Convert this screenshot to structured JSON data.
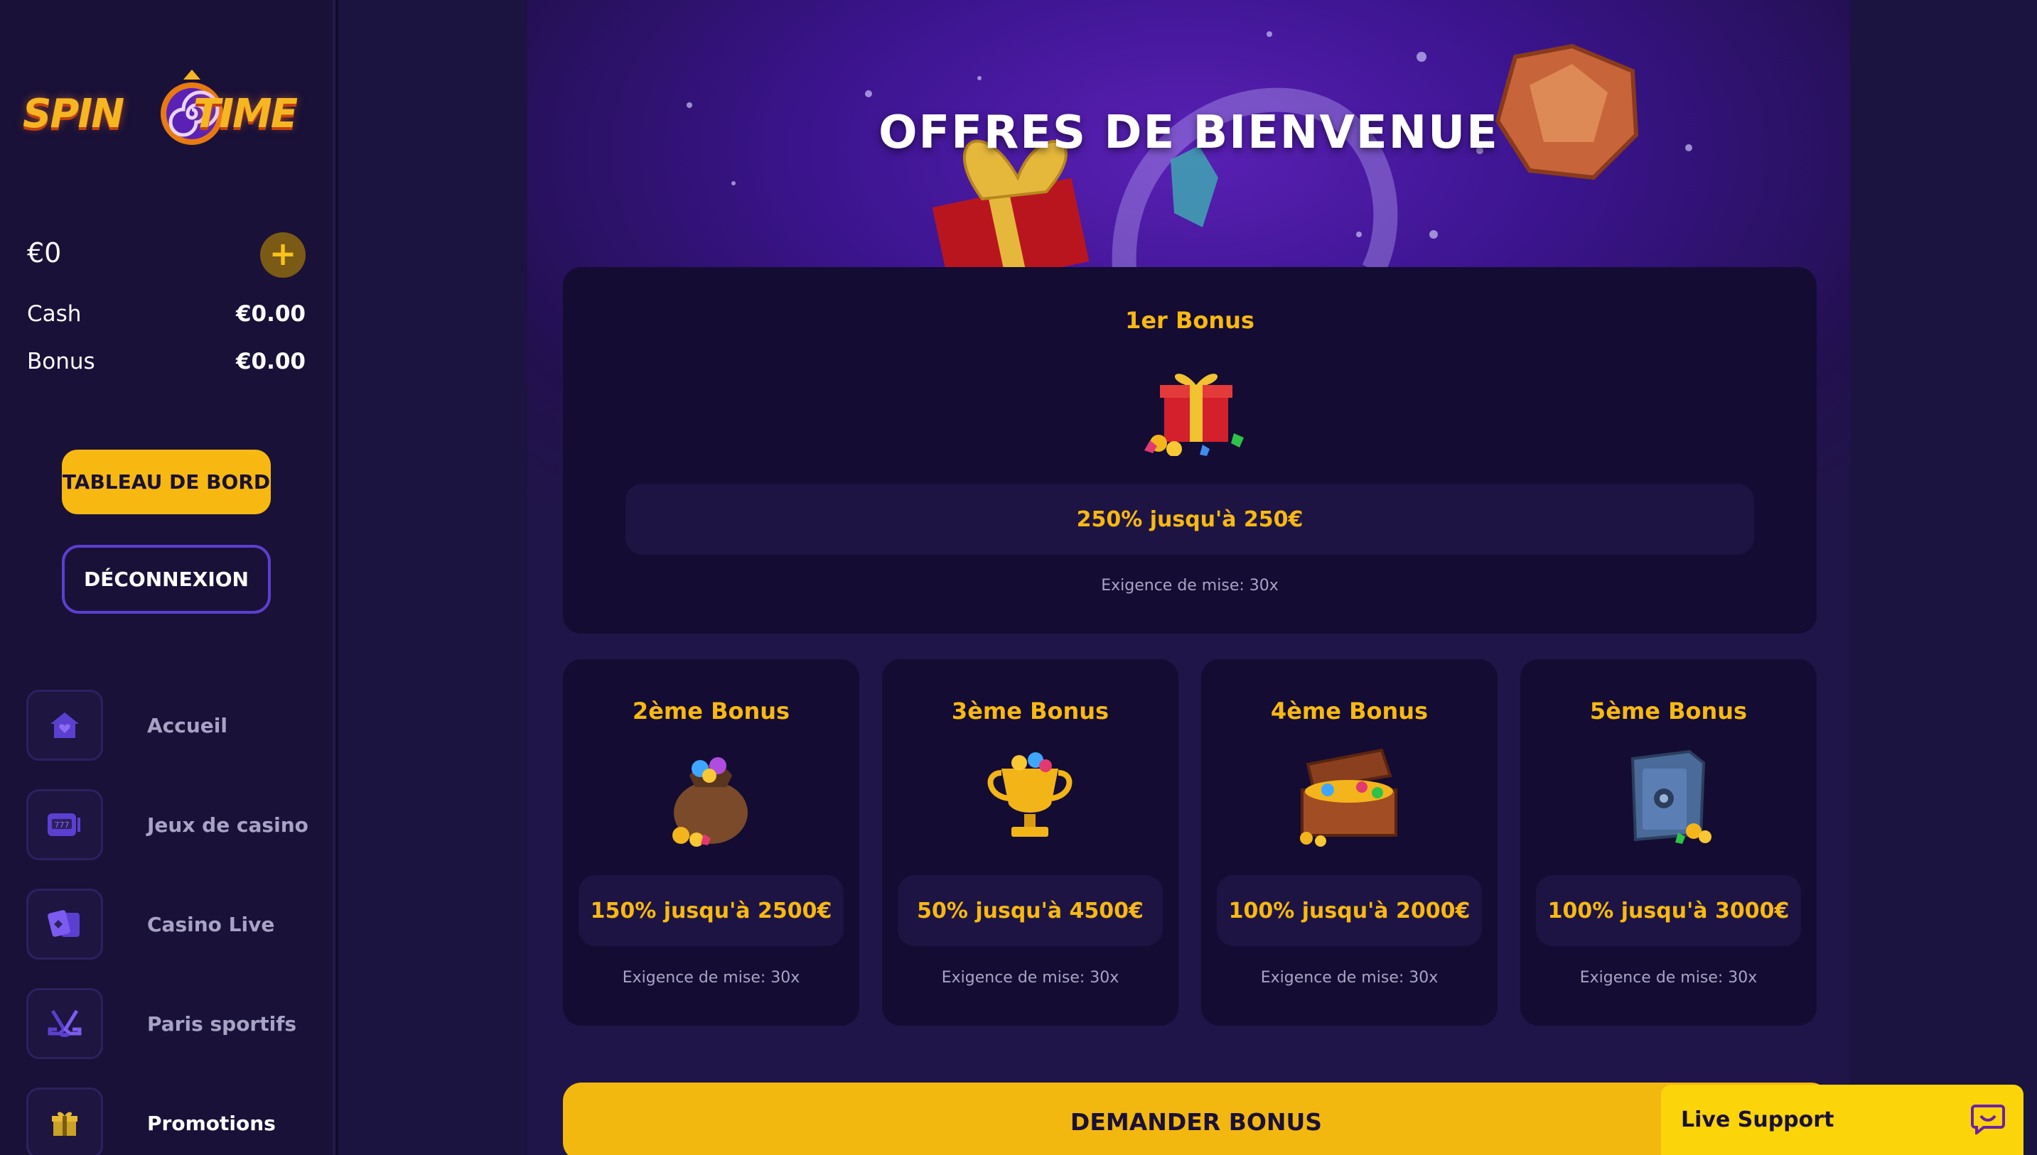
{
  "brand": {
    "logo_word_1": "SPIN",
    "logo_word_2": "TIME"
  },
  "balance": {
    "total": "€0",
    "add_icon": "plus-icon",
    "cash_label": "Cash",
    "cash_value": "€0.00",
    "bonus_label": "Bonus",
    "bonus_value": "€0.00"
  },
  "sidebar": {
    "dashboard_label": "TABLEAU DE BORD",
    "logout_label": "DÉCONNEXION",
    "nav": [
      {
        "label": "Accueil",
        "icon": "home-icon"
      },
      {
        "label": "Jeux de casino",
        "icon": "slot-machine-icon"
      },
      {
        "label": "Casino Live",
        "icon": "cards-icon"
      },
      {
        "label": "Paris sportifs",
        "icon": "hockey-icon"
      },
      {
        "label": "Promotions",
        "icon": "gift-icon"
      }
    ]
  },
  "main": {
    "title": "OFFRES DE BIENVENUE",
    "bonuses": [
      {
        "title": "1er Bonus",
        "offer": "250% jusqu'à 250€",
        "requirement": "Exigence de mise: 30x",
        "icon": "gift-box-icon"
      },
      {
        "title": "2ème Bonus",
        "offer": "150% jusqu'à 2500€",
        "requirement": "Exigence de mise: 30x",
        "icon": "money-bag-icon"
      },
      {
        "title": "3ème Bonus",
        "offer": "50% jusqu'à 4500€",
        "requirement": "Exigence de mise: 30x",
        "icon": "trophy-icon"
      },
      {
        "title": "4ème Bonus",
        "offer": "100% jusqu'à 2000€",
        "requirement": "Exigence de mise: 30x",
        "icon": "treasure-chest-icon"
      },
      {
        "title": "5ème Bonus",
        "offer": "100% jusqu'à 3000€",
        "requirement": "Exigence de mise: 30x",
        "icon": "safe-icon"
      }
    ],
    "claim_label": "DEMANDER BONUS"
  },
  "support": {
    "label": "Live Support",
    "icon": "chat-icon"
  },
  "colors": {
    "accent": "#f7b911",
    "background": "#201548",
    "sidebar": "#1a1138",
    "card": "#140c33",
    "border": "#5b3fd0"
  }
}
